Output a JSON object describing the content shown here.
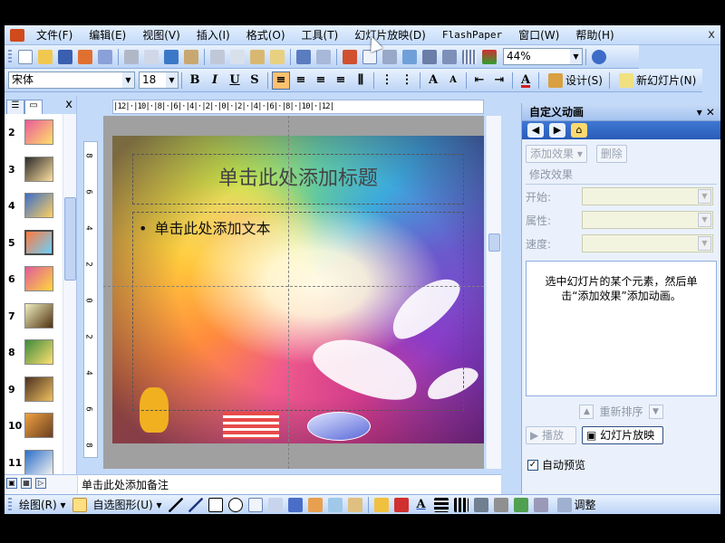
{
  "menubar": {
    "items": [
      "文件(F)",
      "编辑(E)",
      "视图(V)",
      "插入(I)",
      "格式(O)",
      "工具(T)",
      "幻灯片放映(D)",
      "FlashPaper",
      "窗口(W)",
      "帮助(H)"
    ],
    "close": "x"
  },
  "standard_toolbar": {
    "zoom": "44%",
    "icons": [
      "new-icon",
      "open-icon",
      "save-icon",
      "permission-icon",
      "email-icon",
      "print-icon",
      "print-preview-icon",
      "spelling-icon",
      "research-icon",
      "cut-icon",
      "copy-icon",
      "paste-icon",
      "format-painter-icon",
      "undo-icon",
      "redo-icon",
      "insert-chart-icon",
      "insert-table-icon",
      "tables-borders-icon",
      "hyperlink-icon",
      "expand-icon",
      "grid-icon",
      "color-icon",
      "help-icon"
    ]
  },
  "format_toolbar": {
    "font": "宋体",
    "size": "18",
    "bold": "B",
    "italic": "I",
    "underline": "U",
    "shadow": "S",
    "design": "设计(S)",
    "new_slide": "新幻灯片(N)"
  },
  "left_panel": {
    "tabs": [
      "outline",
      "slides"
    ],
    "close": "x",
    "slides": [
      {
        "n": "2",
        "colors": [
          "#e85a9a",
          "#ffe06a"
        ]
      },
      {
        "n": "3",
        "colors": [
          "#2a2a2a",
          "#ffe0a0"
        ]
      },
      {
        "n": "4",
        "colors": [
          "#3a6ec8",
          "#ffd060"
        ]
      },
      {
        "n": "5",
        "colors": [
          "#ff7a3c",
          "#6ad0ff"
        ]
      },
      {
        "n": "6",
        "colors": [
          "#e05a9a",
          "#ffd83c"
        ]
      },
      {
        "n": "7",
        "colors": [
          "#f0f0c0",
          "#503010"
        ]
      },
      {
        "n": "8",
        "colors": [
          "#3c8a3c",
          "#ffe070"
        ]
      },
      {
        "n": "9",
        "colors": [
          "#4a3020",
          "#f0c060"
        ]
      },
      {
        "n": "10",
        "colors": [
          "#f0a040",
          "#6a4020"
        ]
      },
      {
        "n": "11",
        "colors": [
          "#2a6ec8",
          "#f0f0f0"
        ]
      }
    ],
    "selected": "5"
  },
  "ruler": {
    "horizontal": "|12|·|10|·|8|·|6|·|4|·|2|·|0|·|2|·|4|·|6|·|8|·|10|·|12|",
    "vertical": [
      "8",
      "6",
      "4",
      "2",
      "0",
      "2",
      "4",
      "6",
      "8"
    ]
  },
  "slide": {
    "title_placeholder": "单击此处添加标题",
    "body_placeholder": "单击此处添加文本",
    "bullet": "•"
  },
  "notes": {
    "placeholder": "单击此处添加备注"
  },
  "task_pane": {
    "title": "自定义动画",
    "add_effect": "添加效果 ▾",
    "remove": "删除",
    "modify_label": "修改效果",
    "start_label": "开始:",
    "property_label": "属性:",
    "speed_label": "速度:",
    "hint": "选中幻灯片的某个元素，然后单击“添加效果”添加动画。",
    "reorder": "重新排序",
    "play": "播放",
    "slideshow": "幻灯片放映",
    "autopreview": "自动预览",
    "autopreview_checked": "✓"
  },
  "drawing_toolbar": {
    "draw": "绘图(R) ▾",
    "autoshapes": "自选图形(U) ▾",
    "adjust": "调整"
  }
}
